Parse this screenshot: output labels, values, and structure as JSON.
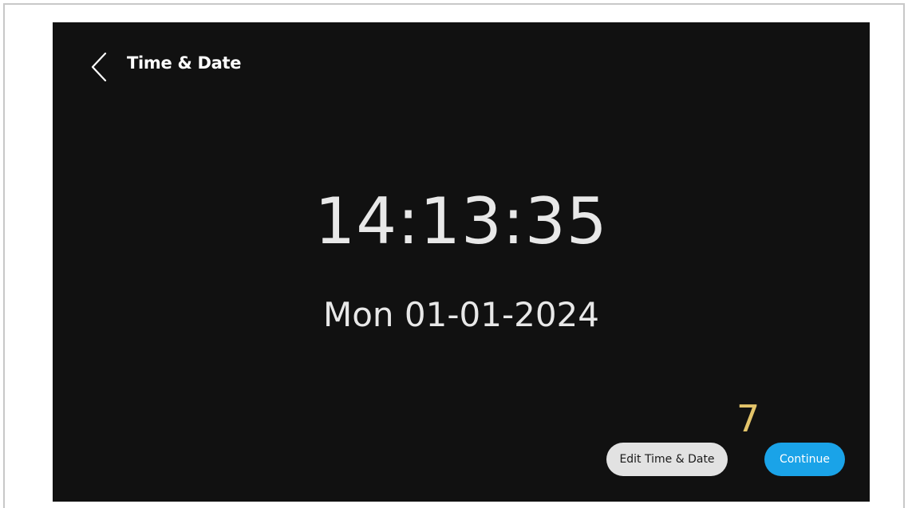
{
  "header": {
    "title": "Time & Date",
    "back_icon": "chevron-left-icon"
  },
  "clock": {
    "time": "14:13:35",
    "date": "Mon 01-01-2024"
  },
  "callout": {
    "number": "7"
  },
  "actions": {
    "edit_label": "Edit Time & Date",
    "continue_label": "Continue"
  },
  "colors": {
    "background": "#111111",
    "text": "#e8e8e8",
    "accent": "#1aa3e8",
    "secondary_button": "#e2e2e2",
    "callout": "#e3c46a"
  }
}
